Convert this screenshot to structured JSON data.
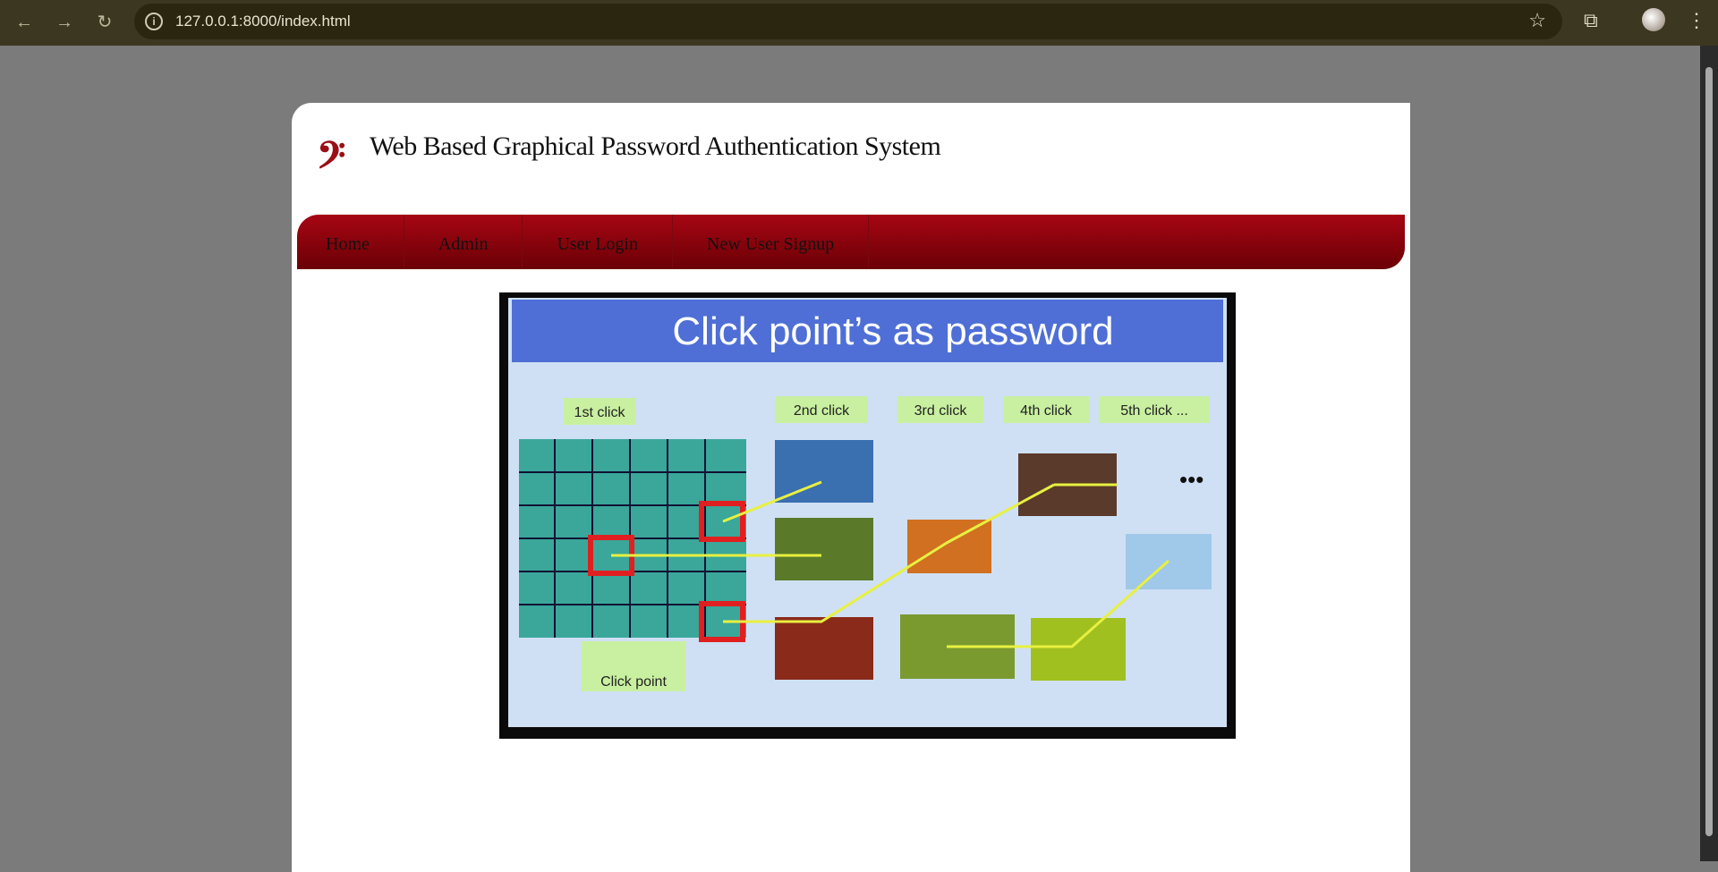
{
  "browser": {
    "url": "127.0.0.1:8000/index.html"
  },
  "header": {
    "logo": "𝄢",
    "title": "Web Based Graphical Password Authentication System"
  },
  "nav": [
    {
      "label": "Home"
    },
    {
      "label": "Admin"
    },
    {
      "label": "User Login"
    },
    {
      "label": "New User Signup"
    }
  ],
  "hero": {
    "heading": "Click point’s as password",
    "clicks": [
      "1st click",
      "2nd click",
      "3rd click",
      "4th click",
      "5th click ..."
    ],
    "click_point": "Click point",
    "ellipsis": "•••"
  }
}
